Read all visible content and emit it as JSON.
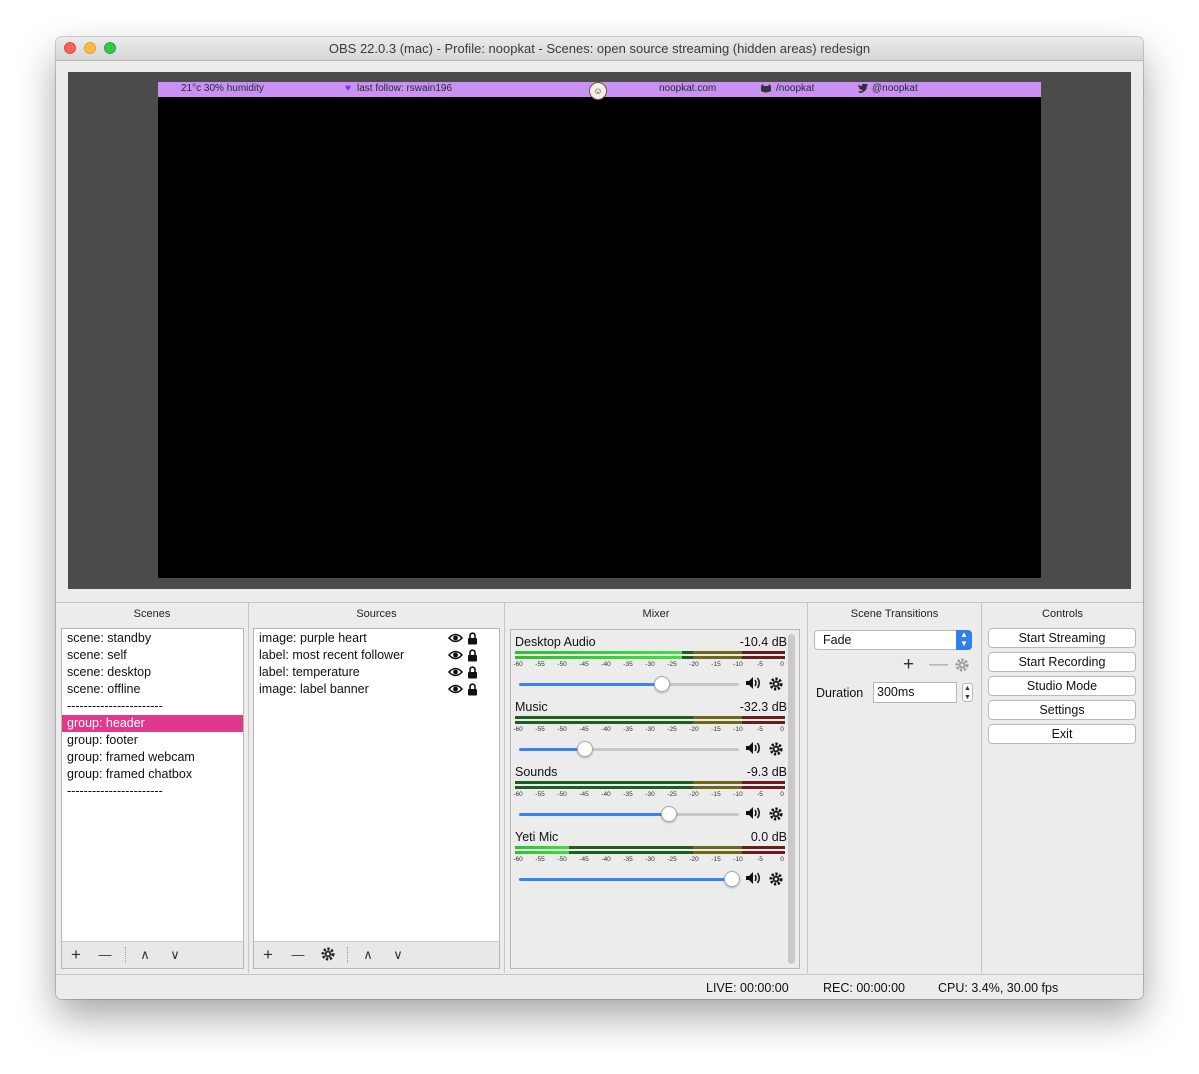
{
  "window": {
    "title": "OBS 22.0.3 (mac) - Profile: noopkat - Scenes: open source streaming (hidden areas) redesign"
  },
  "preview": {
    "banner": {
      "weather": "21°c 30% humidity",
      "follow": "last follow: rswain196",
      "site": "noopkat.com",
      "github": "/noopkat",
      "twitter": "@noopkat"
    }
  },
  "scenes": {
    "title": "Scenes",
    "items": [
      "scene: standby",
      "scene: self",
      "scene: desktop",
      "scene: offline",
      "-----------------------",
      "group: header",
      "group: footer",
      "group: framed webcam",
      "group: framed chatbox",
      "-----------------------"
    ],
    "selected_index": 5,
    "toolbar": {
      "add": "+",
      "remove": "—",
      "up": "∧",
      "down": "∨"
    }
  },
  "sources": {
    "title": "Sources",
    "items": [
      "image: purple heart",
      "label: most recent follower",
      "label: temperature",
      "image: label banner"
    ],
    "toolbar": {
      "add": "+",
      "remove": "—",
      "up": "∧",
      "down": "∨"
    }
  },
  "mixer": {
    "title": "Mixer",
    "scale_labels": [
      "-60",
      "-55",
      "-50",
      "-45",
      "-40",
      "-35",
      "-30",
      "-25",
      "-20",
      "-15",
      "-10",
      "-5",
      "0"
    ],
    "channels": [
      {
        "name": "Desktop Audio",
        "db": "-10.4 dB",
        "volume": 0.65,
        "meter_level": 0.62
      },
      {
        "name": "Music",
        "db": "-32.3 dB",
        "volume": 0.3,
        "meter_level": 0.0
      },
      {
        "name": "Sounds",
        "db": "-9.3 dB",
        "volume": 0.68,
        "meter_level": 0.0
      },
      {
        "name": "Yeti Mic",
        "db": "0.0 dB",
        "volume": 0.97,
        "meter_level": 0.2
      }
    ]
  },
  "transitions": {
    "title": "Scene Transitions",
    "selected": "Fade",
    "duration_label": "Duration",
    "duration_value": "300ms"
  },
  "controls": {
    "title": "Controls",
    "buttons": [
      "Start Streaming",
      "Start Recording",
      "Studio Mode",
      "Settings",
      "Exit"
    ]
  },
  "status": {
    "live": "LIVE: 00:00:00",
    "rec": "REC: 00:00:00",
    "cpu": "CPU: 3.4%, 30.00 fps"
  },
  "colors": {
    "selected": "#e0398c",
    "banner": "#c891f3",
    "slider": "#3b82f6"
  }
}
